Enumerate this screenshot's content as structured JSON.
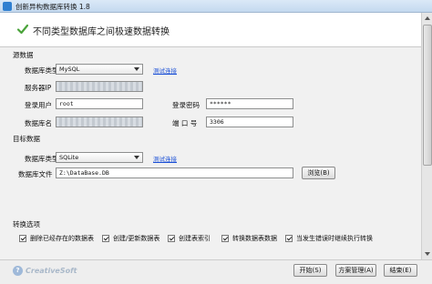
{
  "window": {
    "title": "创新异构数据库转换 1.8"
  },
  "header": {
    "title": "不同类型数据库之间极速数据转换"
  },
  "source": {
    "section_label": "源数据",
    "db_type_label": "数据库类型",
    "db_type_value": "MySQL",
    "test_link": "测试连接",
    "server_ip_label": "服务器IP",
    "server_ip_value": "",
    "login_user_label": "登录用户",
    "login_user_value": "root",
    "login_password_label": "登录密码",
    "login_password_value": "******",
    "db_name_label": "数据库名",
    "db_name_value": "",
    "port_label": "端 口 号",
    "port_value": "3306"
  },
  "target": {
    "section_label": "目标数据",
    "db_type_label": "数据库类型",
    "db_type_value": "SQLite",
    "test_link": "测试连接",
    "db_file_label": "数据库文件",
    "db_file_value": "Z:\\DataBase.DB",
    "browse_button": "浏览(B)"
  },
  "options": {
    "section_label": "转换选项",
    "items": [
      {
        "label": "删除已经存在的数据表",
        "checked": true
      },
      {
        "label": "创建/更新数据表",
        "checked": true
      },
      {
        "label": "创建表索引",
        "checked": true
      },
      {
        "label": "转换数据表数据",
        "checked": true
      },
      {
        "label": "当发生错误时继续执行转换",
        "checked": true
      }
    ]
  },
  "footer": {
    "logo_text": "CreativeSoft",
    "start_button": "开始(S)",
    "scheme_button": "方案管理(A)",
    "finish_button": "结束(E)"
  },
  "icons": {
    "header": "check-icon",
    "logo": "help-circle-icon"
  },
  "colors": {
    "link": "#1a4fd6",
    "check_accent": "#4aa33a",
    "titlebar": "#dbe9f7"
  }
}
